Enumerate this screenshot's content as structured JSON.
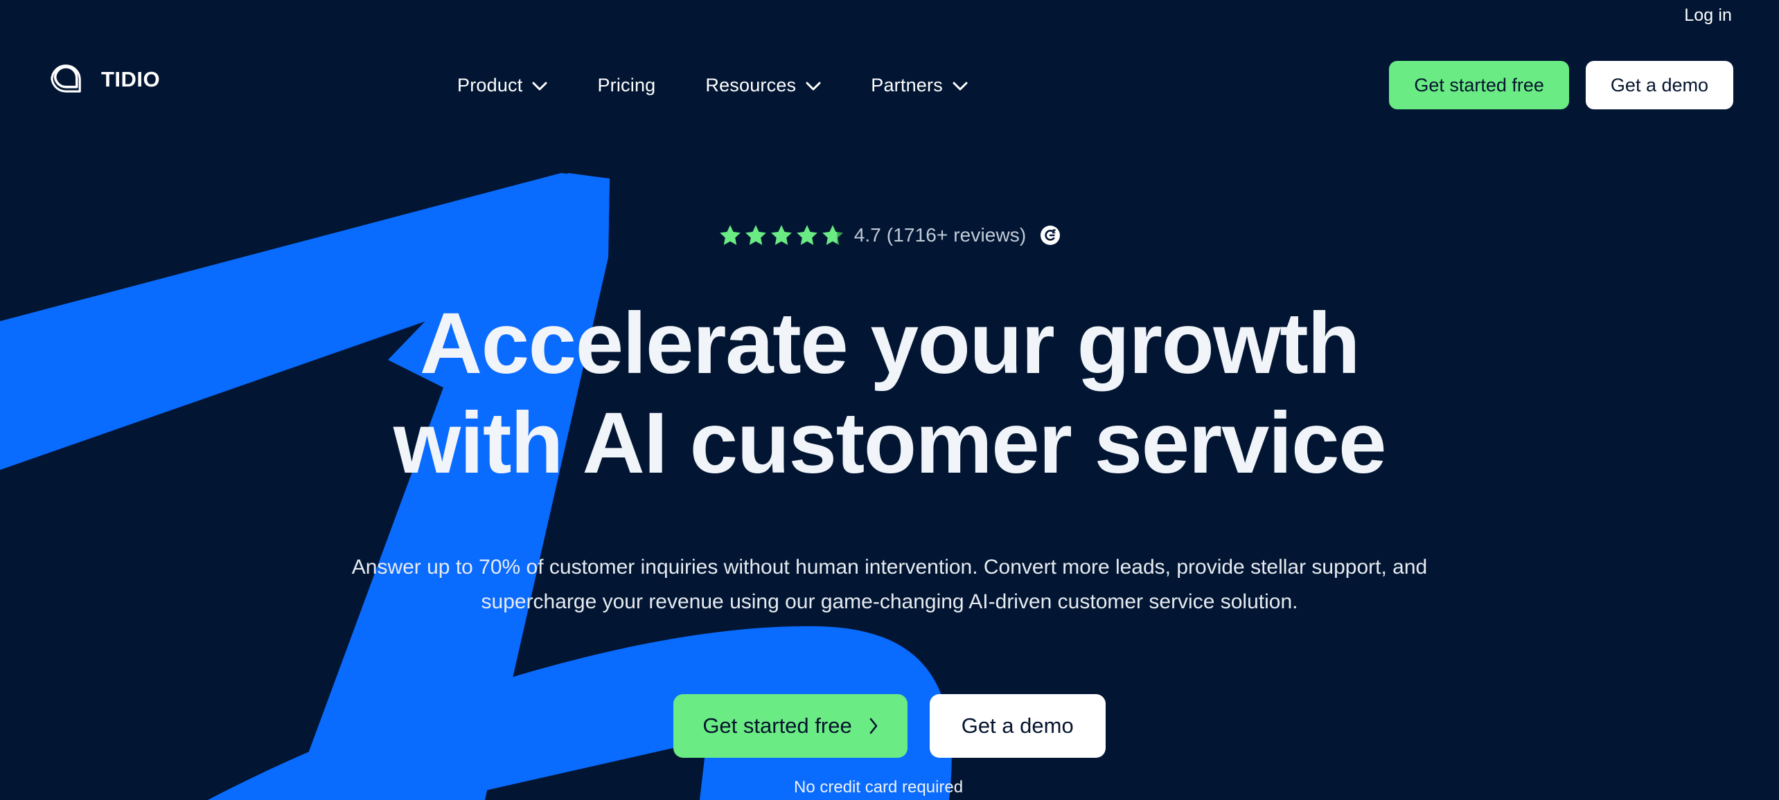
{
  "colors": {
    "background": "#021633",
    "accent_blue": "#0A6BFF",
    "accent_green": "#6BEB83",
    "text_light": "#F1F4F8",
    "text_muted": "#C2CBD8",
    "button_text_dark": "#04142E"
  },
  "topbar": {
    "login_label": "Log in"
  },
  "brand": {
    "logo_icon": "tidio-logo-icon",
    "wordmark": "TIDIO"
  },
  "nav": {
    "items": [
      {
        "label": "Product",
        "has_dropdown": true,
        "icon": "chevron-down-icon"
      },
      {
        "label": "Pricing",
        "has_dropdown": false,
        "icon": ""
      },
      {
        "label": "Resources",
        "has_dropdown": true,
        "icon": "chevron-down-icon"
      },
      {
        "label": "Partners",
        "has_dropdown": true,
        "icon": "chevron-down-icon"
      }
    ]
  },
  "header_actions": {
    "primary_label": "Get started free",
    "secondary_label": "Get a demo"
  },
  "hero": {
    "rating": {
      "stars_icon": "star-icon",
      "stars_filled": 4.7,
      "stars_total": 5,
      "text": "4.7 (1716+ reviews)",
      "score": "4.7",
      "review_count": "1716+",
      "badge_icon": "g2-logo-icon",
      "badge_label": "G2"
    },
    "title_line_1": "Accelerate your growth",
    "title_line_2": "with AI customer service",
    "subtitle": "Answer up to 70% of customer inquiries without human intervention. Convert more leads, provide stellar support, and supercharge your revenue using our game-changing AI-driven customer service solution.",
    "primary_cta": "Get started free",
    "primary_cta_icon": "chevron-right-icon",
    "secondary_cta": "Get a demo",
    "note": "No credit card required"
  }
}
